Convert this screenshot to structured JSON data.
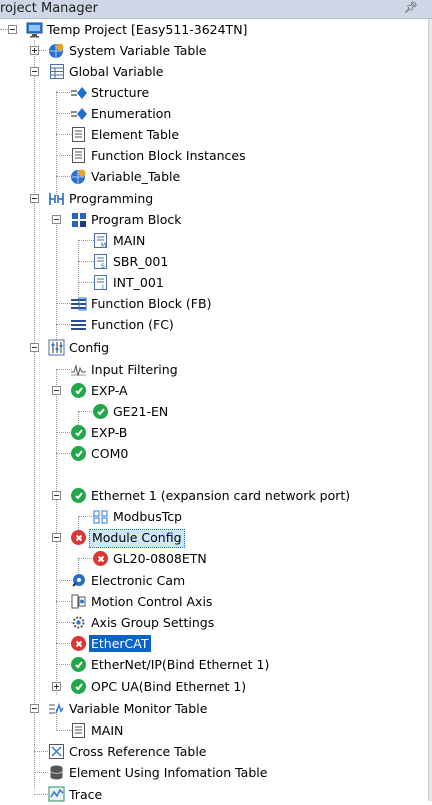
{
  "panel": {
    "title": "roject Manager",
    "pin_glyph": "☉"
  },
  "tree": {
    "root": "Temp Project [Easy511-3624TN]",
    "system_variable_table": "System Variable Table",
    "global_variable": {
      "label": "Global Variable",
      "structure": "Structure",
      "enumeration": "Enumeration",
      "element_table": "Element Table",
      "fb_instances": "Function Block Instances",
      "variable_table": "Variable_Table"
    },
    "programming": {
      "label": "Programming",
      "program_block": "Program Block",
      "main": "MAIN",
      "sbr": "SBR_001",
      "intr": "INT_001",
      "function_block": "Function Block (FB)",
      "function": "Function (FC)"
    },
    "config": {
      "label": "Config",
      "input_filtering": "Input Filtering",
      "exp_a": "EXP-A",
      "ge21": "GE21-EN",
      "exp_b": "EXP-B",
      "com0": "COM0",
      "ethernet1": "Ethernet 1 (expansion card network port)",
      "modbustcp": "ModbusTcp",
      "module_config": "Module Config",
      "gl20": "GL20-0808ETN",
      "electronic_cam": "Electronic Cam",
      "motion_axis": "Motion Control Axis",
      "axis_group": "Axis Group Settings",
      "ethercat": "EtherCAT",
      "ethernet_ip": "EtherNet/IP(Bind Ethernet 1)",
      "opc_ua": "OPC UA(Bind Ethernet 1)"
    },
    "variable_monitor": {
      "label": "Variable Monitor Table",
      "main": "MAIN"
    },
    "cross_reference": "Cross Reference Table",
    "element_using": "Element Using Infomation Table",
    "trace": "Trace"
  },
  "status_colors": {
    "ok": "#22a64a",
    "error": "#de3535",
    "selection": "#0a64c8"
  }
}
